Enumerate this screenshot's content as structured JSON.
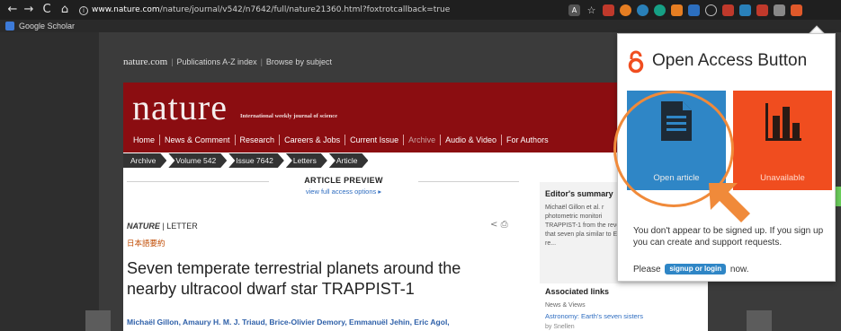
{
  "browser": {
    "url_host": "www.nature.com",
    "url_path": "/nature/journal/v542/n7642/full/nature21360.html?foxtrotcallback=true",
    "bookmark": "Google Scholar"
  },
  "site_nav": {
    "logo": "nature.com",
    "items": [
      "Publications A-Z index",
      "Browse by subject"
    ]
  },
  "masthead": {
    "logo": "nature",
    "tagline": "International weekly journal of science",
    "menu": [
      "Home",
      "News & Comment",
      "Research",
      "Careers & Jobs",
      "Current Issue",
      "Archive",
      "Audio & Video",
      "For Authors"
    ]
  },
  "breadcrumbs": [
    "Archive",
    "Volume 542",
    "Issue 7642",
    "Letters",
    "Article"
  ],
  "article": {
    "preview_title": "ARTICLE PREVIEW",
    "preview_link": "view full access options ▸",
    "kicker_journal": "NATURE",
    "kicker_type": "| LETTER",
    "japanese": "日本語要約",
    "headline": "Seven temperate terrestrial planets around the nearby ultracool dwarf star TRAPPIST-1",
    "authors": "Michaël Gillon, Amaury H. M. J. Triaud, Brice-Olivier Demory, Emmanuël Jehin, Eric Agol,"
  },
  "sidebar": {
    "editors_summary_title": "Editor's summary",
    "editors_summary_text": "Michaël Gillon et al. r photometric monitori TRAPPIST-1 from the reveal that seven pla similar to Earth re...",
    "associated_title": "Associated links",
    "news_label": "News & Views",
    "news_link": "Astronomy: Earth's seven sisters",
    "news_by": "by Snellen"
  },
  "popup": {
    "title": "Open Access Button",
    "tile_open_label": "Open article",
    "tile_unavailable_label": "Unavailable",
    "message": "You don't appear to be signed up. If you sign up you can create and support requests.",
    "please": "Please",
    "login_button": "signup or login",
    "now": "now.",
    "colors": {
      "open": "#2f86c6",
      "unavailable": "#f04d1f",
      "highlight": "#f08a3a"
    }
  }
}
